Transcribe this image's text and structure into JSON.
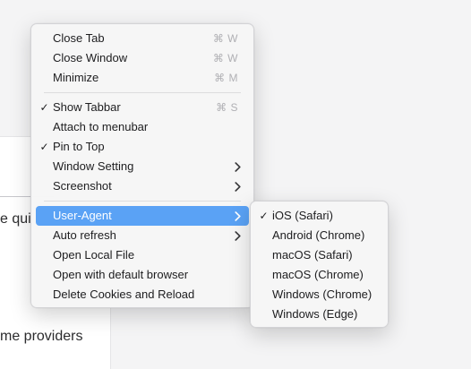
{
  "background": {
    "line1": "e qui",
    "line2": "me providers"
  },
  "menu": {
    "group1": [
      {
        "label": "Close Tab",
        "shortcut": "⌘ W"
      },
      {
        "label": "Close Window",
        "shortcut": "⌘ W"
      },
      {
        "label": "Minimize",
        "shortcut": "⌘ M"
      }
    ],
    "group2": [
      {
        "label": "Show Tabbar",
        "shortcut": "⌘ S",
        "checked": true
      },
      {
        "label": "Attach to menubar"
      },
      {
        "label": "Pin to Top",
        "checked": true
      },
      {
        "label": "Window Setting",
        "submenu": true
      },
      {
        "label": "Screenshot",
        "submenu": true
      }
    ],
    "group3": [
      {
        "label": "User-Agent",
        "submenu": true,
        "highlighted": true
      },
      {
        "label": "Auto refresh",
        "submenu": true
      },
      {
        "label": "Open Local File"
      },
      {
        "label": "Open with default browser"
      },
      {
        "label": "Delete Cookies and Reload"
      }
    ]
  },
  "submenu": {
    "items": [
      {
        "label": "iOS (Safari)",
        "checked": true
      },
      {
        "label": "Android (Chrome)"
      },
      {
        "label": "macOS (Safari)"
      },
      {
        "label": "macOS (Chrome)"
      },
      {
        "label": "Windows (Chrome)"
      },
      {
        "label": "Windows (Edge)"
      }
    ]
  },
  "glyphs": {
    "check": "✓"
  },
  "colors": {
    "highlight": "#5aa2f5",
    "shortcut": "#b0b0b4"
  }
}
